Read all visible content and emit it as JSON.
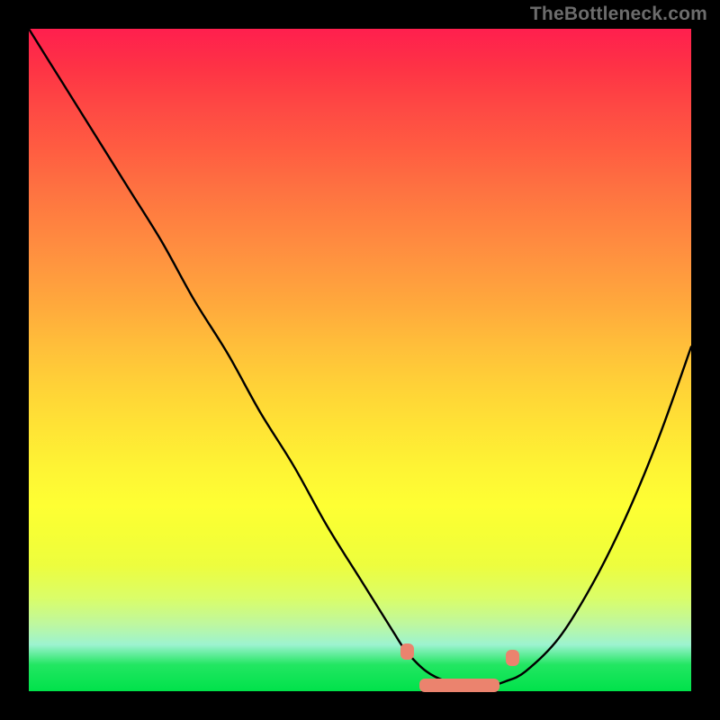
{
  "watermark": "TheBottleneck.com",
  "chart_data": {
    "type": "line",
    "title": "",
    "xlabel": "",
    "ylabel": "",
    "xlim": [
      0,
      100
    ],
    "ylim": [
      0,
      100
    ],
    "legend": false,
    "grid": false,
    "series": [
      {
        "name": "bottleneck-curve",
        "x": [
          0,
          5,
          10,
          15,
          20,
          25,
          30,
          35,
          40,
          45,
          50,
          55,
          57,
          60,
          63,
          66,
          70,
          72,
          75,
          80,
          85,
          90,
          95,
          100
        ],
        "y": [
          100,
          92,
          84,
          76,
          68,
          59,
          51,
          42,
          34,
          25,
          17,
          9,
          6,
          3,
          1.5,
          1,
          1,
          1.5,
          3,
          8,
          16,
          26,
          38,
          52
        ]
      }
    ],
    "markers": [
      {
        "name": "optimal-range-left",
        "x": 57,
        "y": 6
      },
      {
        "name": "optimal-range-band",
        "x0": 59,
        "x1": 71,
        "y": 1
      },
      {
        "name": "optimal-range-right",
        "x": 73,
        "y": 5
      }
    ],
    "gradient_stops": [
      {
        "pos": 0,
        "color": "#ff1f4e"
      },
      {
        "pos": 50,
        "color": "#ffbf3a"
      },
      {
        "pos": 75,
        "color": "#feff33"
      },
      {
        "pos": 100,
        "color": "#00e24a"
      }
    ]
  }
}
